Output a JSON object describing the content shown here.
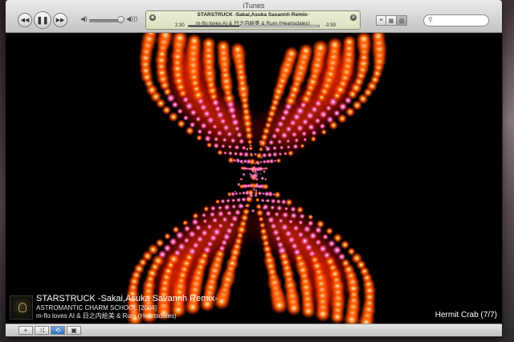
{
  "window": {
    "title": "iTunes"
  },
  "controls": {
    "previous_icon": "rewind-icon",
    "play_pause_icon": "pause-icon",
    "next_icon": "fast-forward-icon"
  },
  "now_playing_display": {
    "title": "STARSTRUCK -Sakai,Asuka Savannh Remix-",
    "artist": "m-flo loves AI & 日之内絵美 & Rum (Heartsdales)",
    "elapsed": "2:30",
    "remaining": "-3:59",
    "progress": 0.39
  },
  "visualizer_overlay": {
    "title": "STARSTRUCK -Sakai,Asuka Savannh Remix-",
    "album": "ASTROMANTIC CHARM SCHOOL [2004]",
    "artist": "m-flo loves AI & 日之内絵美 & Rum (Heartsdales)",
    "visualizer_name": "Hermit Crab (7/7)"
  },
  "colors": {
    "visual_core": "#ffffff",
    "visual_mid": "#ff4fa8",
    "visual_outer": "#ff6a00"
  }
}
